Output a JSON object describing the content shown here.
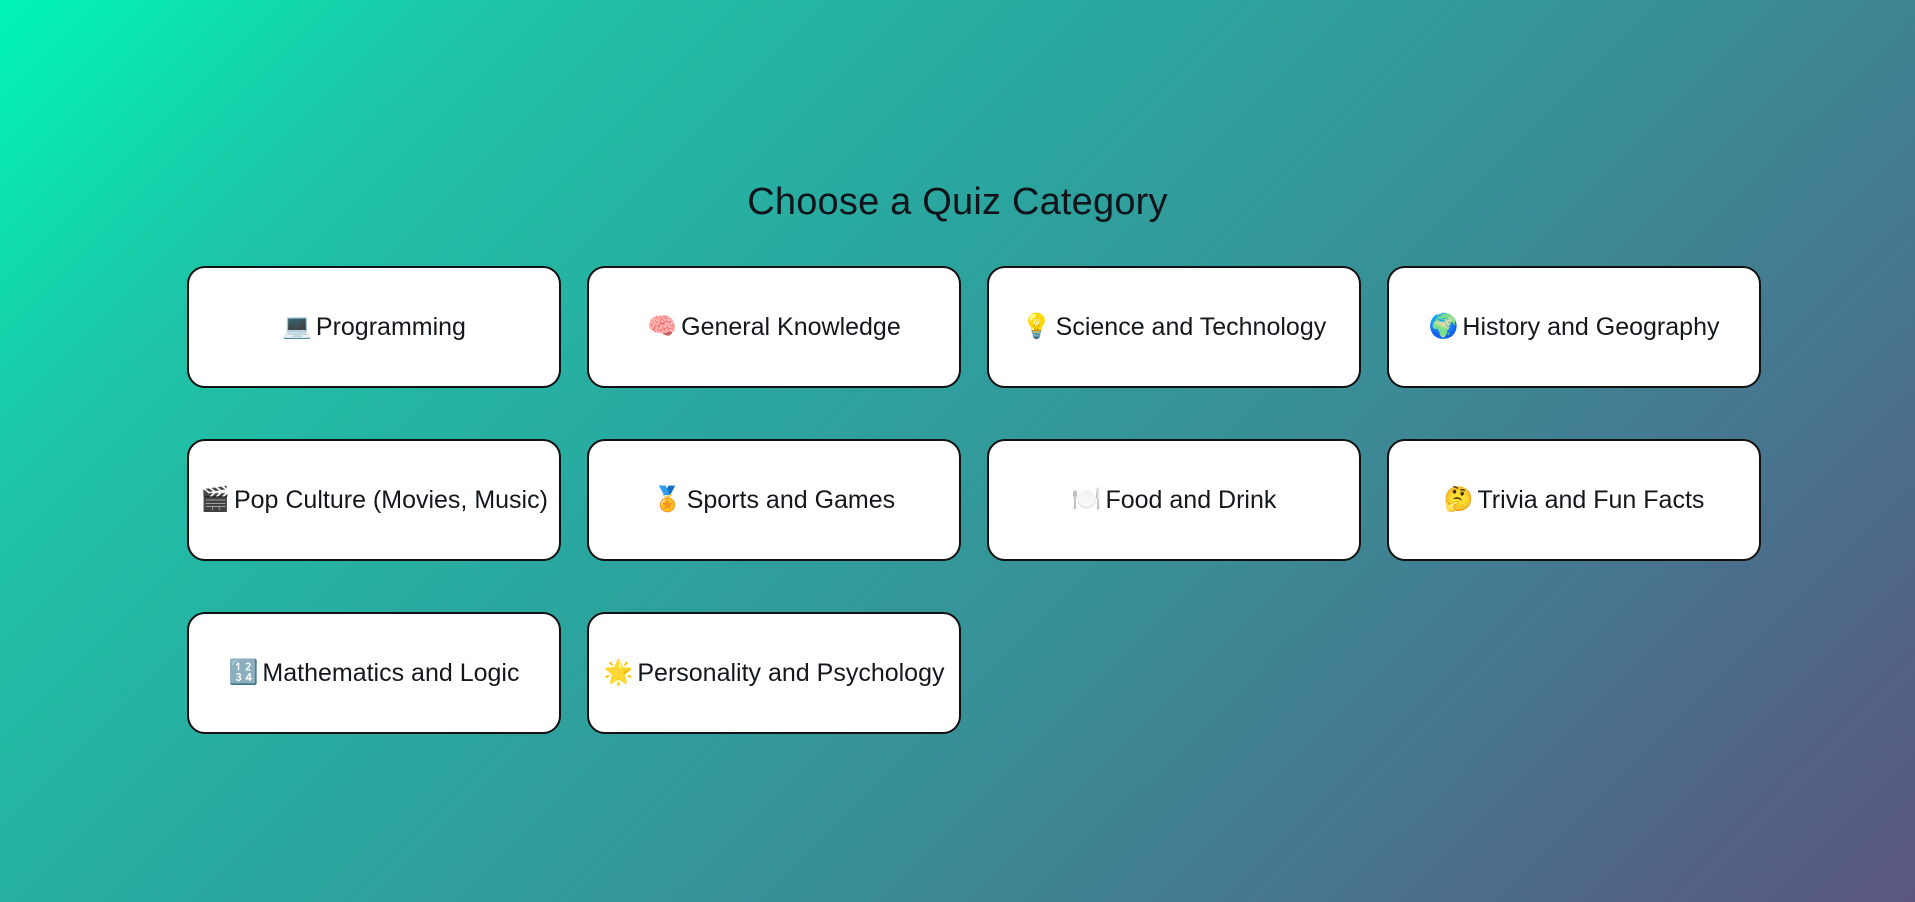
{
  "page": {
    "title": "Choose a Quiz Category"
  },
  "categories": [
    {
      "icon": "💻",
      "icon_name": "laptop-icon",
      "label": "Programming"
    },
    {
      "icon": "🧠",
      "icon_name": "brain-icon",
      "label": "General Knowledge"
    },
    {
      "icon": "💡",
      "icon_name": "lightbulb-icon",
      "label": "Science and Technology"
    },
    {
      "icon": "🌍",
      "icon_name": "globe-icon",
      "label": "History and Geography"
    },
    {
      "icon": "🎬",
      "icon_name": "clapperboard-icon",
      "label": "Pop Culture (Movies, Music)"
    },
    {
      "icon": "🏅",
      "icon_name": "medal-icon",
      "label": "Sports and Games"
    },
    {
      "icon": "🍽️",
      "icon_name": "plate-icon",
      "label": "Food and Drink"
    },
    {
      "icon": "🤔",
      "icon_name": "thinking-face-icon",
      "label": "Trivia and Fun Facts"
    },
    {
      "icon": "🔢",
      "icon_name": "numbers-icon",
      "label": "Mathematics and Logic"
    },
    {
      "icon": "🌟",
      "icon_name": "star-icon",
      "label": "Personality and Psychology"
    }
  ]
}
